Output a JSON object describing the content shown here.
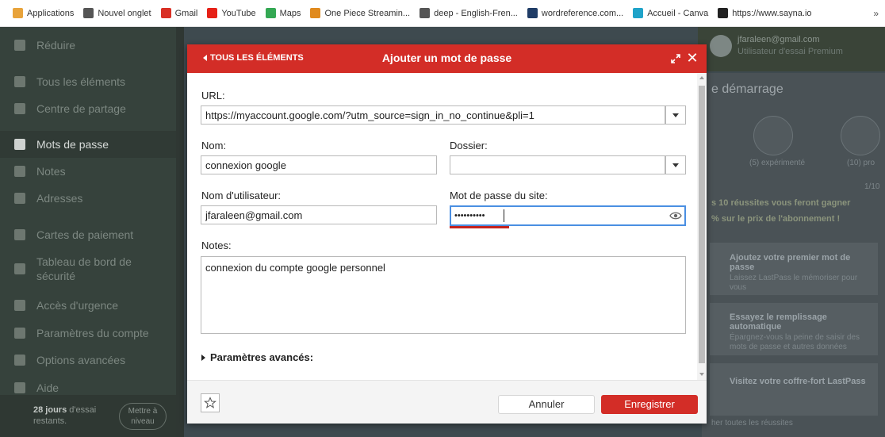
{
  "bookmarks": [
    {
      "label": "Applications",
      "icon": "apps-grid-icon",
      "color": "#e8a33b"
    },
    {
      "label": "Nouvel onglet",
      "icon": "globe-icon",
      "color": "#555555"
    },
    {
      "label": "Gmail",
      "icon": "gmail-icon",
      "color": "#d93025"
    },
    {
      "label": "YouTube",
      "icon": "youtube-icon",
      "color": "#e62117"
    },
    {
      "label": "Maps",
      "icon": "maps-icon",
      "color": "#34a853"
    },
    {
      "label": "One Piece Streamin...",
      "icon": "one-piece-icon",
      "color": "#e08a1e"
    },
    {
      "label": "deep - English-Fren...",
      "icon": "globe-icon",
      "color": "#555555"
    },
    {
      "label": "wordreference.com...",
      "icon": "wordreference-icon",
      "color": "#1f3c66"
    },
    {
      "label": "Accueil - Canva",
      "icon": "canva-icon",
      "color": "#1fa3c9"
    },
    {
      "label": "https://www.sayna.io",
      "icon": "sayna-icon",
      "color": "#222222"
    }
  ],
  "bookmarks_more": "»",
  "sidebar": {
    "items": [
      {
        "label": "Réduire",
        "icon": "collapse-icon",
        "active": false
      },
      {
        "label": "Tous les éléments",
        "icon": "home-icon",
        "active": false
      },
      {
        "label": "Centre de partage",
        "icon": "share-icon",
        "active": false
      },
      {
        "label": "Mots de passe",
        "icon": "lock-icon",
        "active": true
      },
      {
        "label": "Notes",
        "icon": "note-icon",
        "active": false
      },
      {
        "label": "Adresses",
        "icon": "address-icon",
        "active": false
      },
      {
        "label": "Cartes de paiement",
        "icon": "card-icon",
        "active": false
      },
      {
        "label": "Tableau de bord de sécurité",
        "icon": "shield-icon",
        "active": false
      },
      {
        "label": "Accès d'urgence",
        "icon": "lifebuoy-icon",
        "active": false
      },
      {
        "label": "Paramètres du compte",
        "icon": "gear-icon",
        "active": false
      },
      {
        "label": "Options avancées",
        "icon": "wand-icon",
        "active": false
      },
      {
        "label": "Aide",
        "icon": "help-icon",
        "active": false
      }
    ],
    "trial_days": "28 jours",
    "trial_text": "d'essai restants.",
    "upgrade_label": "Mettre à niveau"
  },
  "user": {
    "email": "jfaraleen@gmail.com",
    "subtitle": "Utilisateur d'essai Premium"
  },
  "right_panel": {
    "title": "e démarrage",
    "medal_label_1": "(5) expérimenté",
    "medal_label_2": "(10) pro",
    "progress": "1/10",
    "promo_bold": "s 10 réussites vous feront gagner",
    "promo_sub": "% sur le prix de l'abonnement !",
    "cards": [
      {
        "title": "Ajoutez votre premier mot de passe",
        "sub": "Laissez LastPass le mémoriser pour vous"
      },
      {
        "title": "Essayez le remplissage automatique",
        "sub": "Épargnez-vous la peine de saisir des mots de passe et autres données"
      },
      {
        "title": "Visitez votre coffre-fort LastPass",
        "sub": ""
      }
    ],
    "footer_link": "her toutes les réussites"
  },
  "modal": {
    "back_label": "TOUS LES ÉLÉMENTS",
    "title": "Ajouter un mot de passe",
    "url_label": "URL:",
    "url_value": "https://myaccount.google.com/?utm_source=sign_in_no_continue&pli=1",
    "name_label": "Nom:",
    "name_value": "connexion google",
    "folder_label": "Dossier:",
    "folder_value": "",
    "username_label": "Nom d'utilisateur:",
    "username_value": "jfaraleen@gmail.com",
    "site_password_label": "Mot de passe du site:",
    "site_password_value": "••••••••••",
    "password_strength": 0.25,
    "notes_label": "Notes:",
    "notes_value": "connexion du compte google personnel",
    "advanced_label": "Paramètres avancés:",
    "cancel_label": "Annuler",
    "save_label": "Enregistrer",
    "accent_color": "#d32d27",
    "focus_color": "#4a8fe2"
  }
}
